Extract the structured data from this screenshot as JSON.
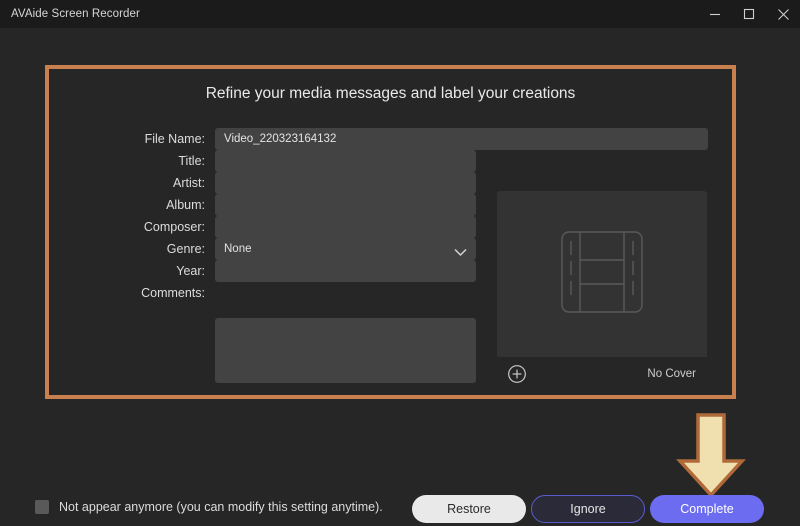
{
  "titlebar": {
    "app_title": "AVAide Screen Recorder",
    "minimize_icon": "minimize-icon",
    "maximize_icon": "maximize-icon",
    "close_icon": "close-icon"
  },
  "panel": {
    "heading": "Refine your media messages and label your creations"
  },
  "form": {
    "fields": [
      {
        "label": "File Name:",
        "value": "Video_220323164132",
        "placeholder": "",
        "type": "text",
        "wide": true
      },
      {
        "label": "Title:",
        "value": "",
        "placeholder": "",
        "type": "text",
        "wide": false
      },
      {
        "label": "Artist:",
        "value": "",
        "placeholder": "",
        "type": "text",
        "wide": false
      },
      {
        "label": "Album:",
        "value": "",
        "placeholder": "",
        "type": "text",
        "wide": false
      },
      {
        "label": "Composer:",
        "value": "",
        "placeholder": "",
        "type": "text",
        "wide": false
      },
      {
        "label": "Genre:",
        "value": "None",
        "placeholder": "",
        "type": "select",
        "wide": false
      },
      {
        "label": "Year:",
        "value": "",
        "placeholder": "",
        "type": "text",
        "wide": false
      },
      {
        "label": "Comments:",
        "value": "",
        "placeholder": "",
        "type": "textarea",
        "wide": false
      }
    ],
    "genre_options": [
      "None"
    ],
    "genre_chevron_icon": "chevron-down-icon"
  },
  "cover": {
    "placeholder_icon": "film-strip-icon",
    "add_icon": "plus-circle-icon",
    "status_label": "No Cover"
  },
  "annotations": {
    "highlight_border_color": "#c8804f",
    "arrow_icon": "arrow-down-icon",
    "arrow_fill_color": "#f0e0b0",
    "arrow_stroke_color": "#b06a3a"
  },
  "footer": {
    "checkbox_label": "Not appear anymore (you can modify this setting anytime).",
    "checkbox_checked": false,
    "restore_label": "Restore",
    "ignore_label": "Ignore",
    "complete_label": "Complete",
    "complete_color": "#6c6cf0",
    "ignore_border_color": "#5b5bd0",
    "restore_color": "#e9e9e9"
  }
}
